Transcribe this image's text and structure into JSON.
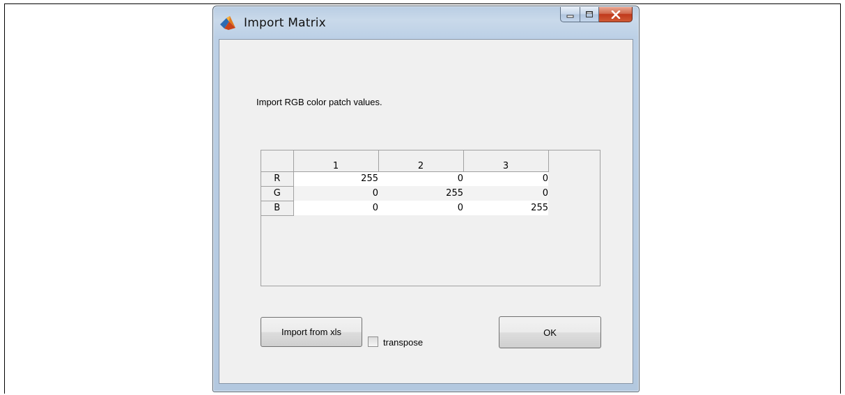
{
  "window": {
    "title": "Import Matrix",
    "icon": "matlab-logo-icon",
    "buttons": [
      "minimize-icon",
      "maximize-icon",
      "close-icon"
    ]
  },
  "dialog": {
    "instructions": "Import RGB color patch values.",
    "table": {
      "columns": [
        "1",
        "2",
        "3"
      ],
      "rows": [
        {
          "label": "R",
          "values": [
            "255",
            "0",
            "0"
          ]
        },
        {
          "label": "G",
          "values": [
            "0",
            "255",
            "0"
          ]
        },
        {
          "label": "B",
          "values": [
            "0",
            "0",
            "255"
          ]
        }
      ]
    },
    "import_button_label": "Import from xls",
    "transpose_label": "transpose",
    "transpose_checked": false,
    "ok_button_label": "OK"
  },
  "colors": {
    "window_frame": "#b9cde3",
    "client_bg": "#f0f0f0",
    "close_button": "#c0391c"
  }
}
